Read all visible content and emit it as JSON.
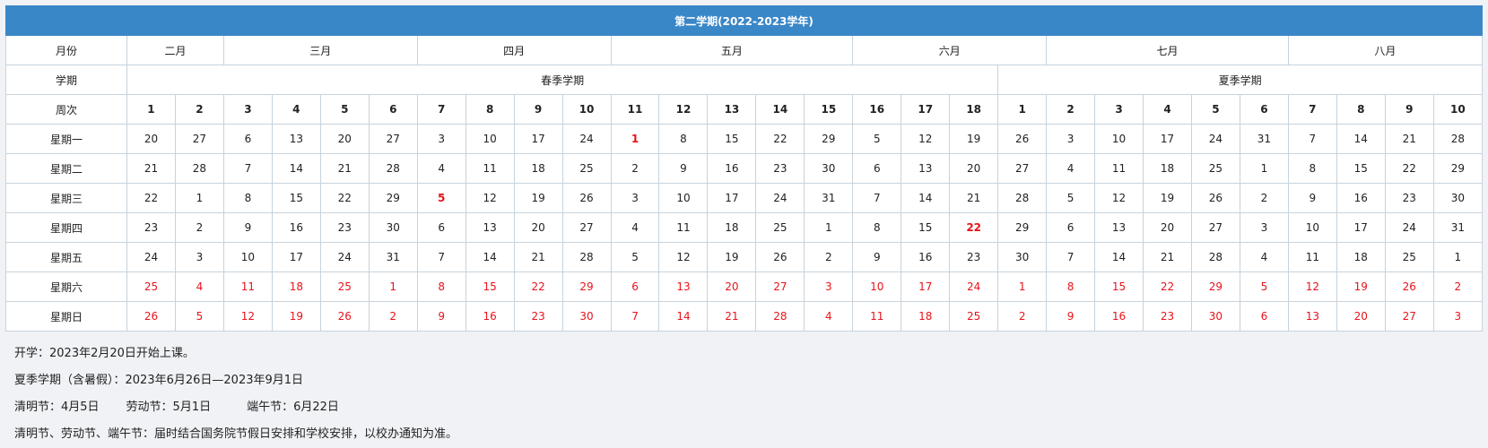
{
  "title": "第二学期(2022-2023学年)",
  "row_labels": {
    "month": "月份",
    "term": "学期",
    "week": "周次"
  },
  "months": [
    {
      "name": "二月",
      "span": 2
    },
    {
      "name": "三月",
      "span": 4
    },
    {
      "name": "四月",
      "span": 4
    },
    {
      "name": "五月",
      "span": 5
    },
    {
      "name": "六月",
      "span": 4
    },
    {
      "name": "七月",
      "span": 5
    },
    {
      "name": "八月",
      "span": 4
    }
  ],
  "terms": [
    {
      "name": "春季学期",
      "span": 18
    },
    {
      "name": "夏季学期",
      "span": 10
    }
  ],
  "weeks": [
    "1",
    "2",
    "3",
    "4",
    "5",
    "6",
    "7",
    "8",
    "9",
    "10",
    "11",
    "12",
    "13",
    "14",
    "15",
    "16",
    "17",
    "18",
    "1",
    "2",
    "3",
    "4",
    "5",
    "6",
    "7",
    "8",
    "9",
    "10"
  ],
  "days": [
    {
      "label": "星期一",
      "weekend": false,
      "dates": [
        "20",
        "27",
        "6",
        "13",
        "20",
        "27",
        "3",
        "10",
        "17",
        "24",
        "1",
        "8",
        "15",
        "22",
        "29",
        "5",
        "12",
        "19",
        "26",
        "3",
        "10",
        "17",
        "24",
        "31",
        "7",
        "14",
        "21",
        "28"
      ]
    },
    {
      "label": "星期二",
      "weekend": false,
      "dates": [
        "21",
        "28",
        "7",
        "14",
        "21",
        "28",
        "4",
        "11",
        "18",
        "25",
        "2",
        "9",
        "16",
        "23",
        "30",
        "6",
        "13",
        "20",
        "27",
        "4",
        "11",
        "18",
        "25",
        "1",
        "8",
        "15",
        "22",
        "29"
      ]
    },
    {
      "label": "星期三",
      "weekend": false,
      "dates": [
        "22",
        "1",
        "8",
        "15",
        "22",
        "29",
        "5",
        "12",
        "19",
        "26",
        "3",
        "10",
        "17",
        "24",
        "31",
        "7",
        "14",
        "21",
        "28",
        "5",
        "12",
        "19",
        "26",
        "2",
        "9",
        "16",
        "23",
        "30"
      ]
    },
    {
      "label": "星期四",
      "weekend": false,
      "dates": [
        "23",
        "2",
        "9",
        "16",
        "23",
        "30",
        "6",
        "13",
        "20",
        "27",
        "4",
        "11",
        "18",
        "25",
        "1",
        "8",
        "15",
        "22",
        "29",
        "6",
        "13",
        "20",
        "27",
        "3",
        "10",
        "17",
        "24",
        "31"
      ]
    },
    {
      "label": "星期五",
      "weekend": false,
      "dates": [
        "24",
        "3",
        "10",
        "17",
        "24",
        "31",
        "7",
        "14",
        "21",
        "28",
        "5",
        "12",
        "19",
        "26",
        "2",
        "9",
        "16",
        "23",
        "30",
        "7",
        "14",
        "21",
        "28",
        "4",
        "11",
        "18",
        "25",
        "1"
      ]
    },
    {
      "label": "星期六",
      "weekend": true,
      "dates": [
        "25",
        "4",
        "11",
        "18",
        "25",
        "1",
        "8",
        "15",
        "22",
        "29",
        "6",
        "13",
        "20",
        "27",
        "3",
        "10",
        "17",
        "24",
        "1",
        "8",
        "15",
        "22",
        "29",
        "5",
        "12",
        "19",
        "26",
        "2"
      ]
    },
    {
      "label": "星期日",
      "weekend": true,
      "dates": [
        "26",
        "5",
        "12",
        "19",
        "26",
        "2",
        "9",
        "16",
        "23",
        "30",
        "7",
        "14",
        "21",
        "28",
        "4",
        "11",
        "18",
        "25",
        "2",
        "9",
        "16",
        "23",
        "30",
        "6",
        "13",
        "20",
        "27",
        "3"
      ]
    }
  ],
  "holidays": [
    {
      "day_index": 0,
      "col": 10
    },
    {
      "day_index": 2,
      "col": 6
    },
    {
      "day_index": 3,
      "col": 17
    }
  ],
  "colors": {
    "header_bg": "#3a87c8",
    "holiday_red": "#e8131b",
    "border": "#c6d3dd"
  },
  "notes": {
    "start": "开学：2023年2月20日开始上课。",
    "summer": "夏季学期（含暑假）：2023年6月26日—2023年9月1日",
    "qingming": "清明节：4月5日",
    "laodong": "劳动节：5月1日",
    "duanwu": "端午节：6月22日",
    "arrangement": "清明节、劳动节、端午节：届时结合国务院节假日安排和学校安排，以校办通知为准。"
  }
}
